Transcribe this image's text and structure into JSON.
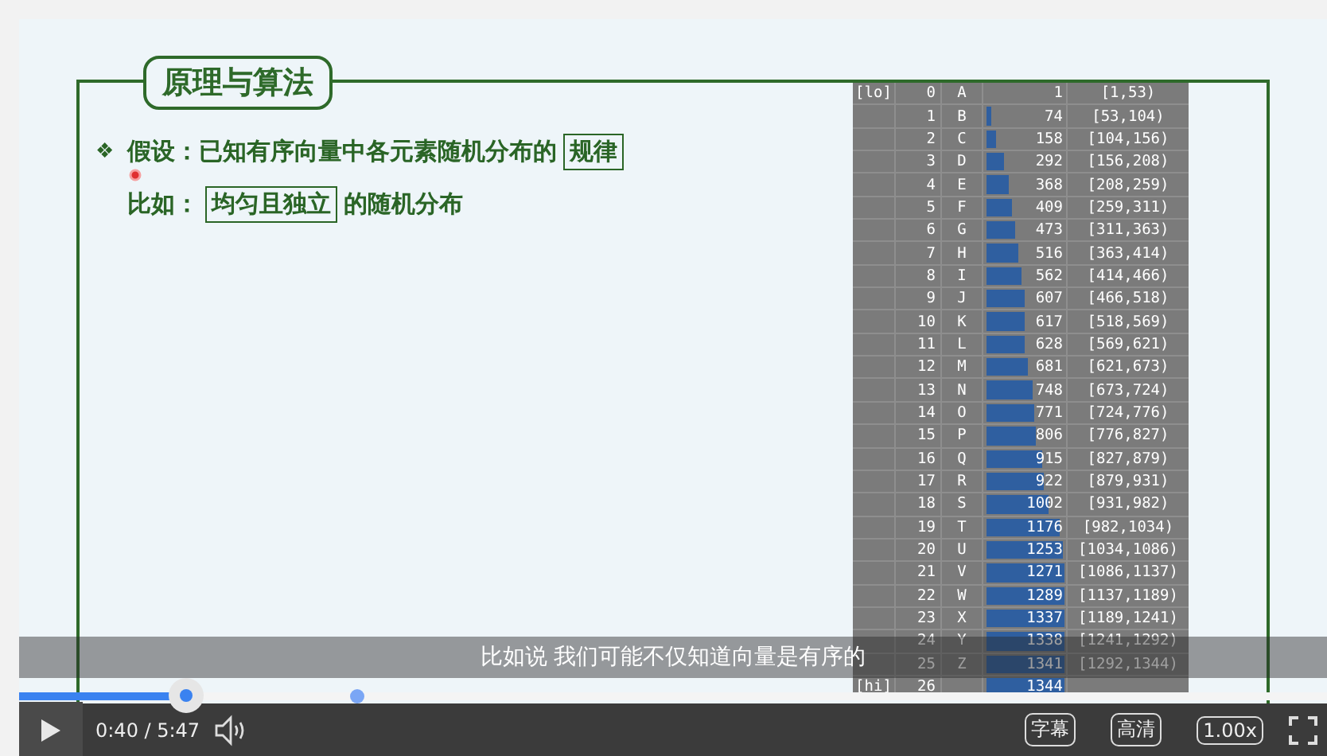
{
  "slide": {
    "title": "原理与算法",
    "lines": [
      {
        "bullet": "❖",
        "segments": [
          {
            "text": "假设：已知有序向量中各元素随机分布的",
            "boxed": false
          },
          {
            "text": "规律",
            "boxed": true
          }
        ]
      },
      {
        "segments": [
          {
            "text": "比如：",
            "boxed": false
          },
          {
            "text": "均匀且独立",
            "boxed": true
          },
          {
            "text": "的随机分布",
            "boxed": false
          }
        ]
      }
    ],
    "table": {
      "rows": [
        {
          "marker": "[lo]",
          "index": "0",
          "key": "A",
          "value": "1",
          "range": "[1,53)"
        },
        {
          "index": "1",
          "key": "B",
          "value": "74",
          "level": 0.055,
          "range": "[53,104)"
        },
        {
          "index": "2",
          "key": "C",
          "value": "158",
          "level": 0.118,
          "range": "[104,156)"
        },
        {
          "index": "3",
          "key": "D",
          "value": "292",
          "level": 0.217,
          "range": "[156,208)"
        },
        {
          "index": "4",
          "key": "E",
          "value": "368",
          "level": 0.274,
          "range": "[208,259)"
        },
        {
          "index": "5",
          "key": "F",
          "value": "409",
          "level": 0.304,
          "range": "[259,311)"
        },
        {
          "index": "6",
          "key": "G",
          "value": "473",
          "level": 0.352,
          "range": "[311,363)"
        },
        {
          "index": "7",
          "key": "H",
          "value": "516",
          "level": 0.384,
          "range": "[363,414)"
        },
        {
          "index": "8",
          "key": "I",
          "value": "562",
          "level": 0.418,
          "range": "[414,466)"
        },
        {
          "index": "9",
          "key": "J",
          "value": "607",
          "level": 0.452,
          "range": "[466,518)"
        },
        {
          "index": "10",
          "key": "K",
          "value": "617",
          "level": 0.459,
          "range": "[518,569)"
        },
        {
          "index": "11",
          "key": "L",
          "value": "628",
          "level": 0.467,
          "range": "[569,621)"
        },
        {
          "index": "12",
          "key": "M",
          "value": "681",
          "level": 0.507,
          "range": "[621,673)"
        },
        {
          "index": "13",
          "key": "N",
          "value": "748",
          "level": 0.557,
          "range": "[673,724)"
        },
        {
          "index": "14",
          "key": "O",
          "value": "771",
          "level": 0.574,
          "range": "[724,776)"
        },
        {
          "index": "15",
          "key": "P",
          "value": "806",
          "level": 0.6,
          "range": "[776,827)"
        },
        {
          "index": "16",
          "key": "Q",
          "value": "915",
          "level": 0.681,
          "range": "[827,879)"
        },
        {
          "index": "17",
          "key": "R",
          "value": "922",
          "level": 0.686,
          "range": "[879,931)"
        },
        {
          "index": "18",
          "key": "S",
          "value": "1002",
          "level": 0.746,
          "range": "[931,982)"
        },
        {
          "index": "19",
          "key": "T",
          "value": "1176",
          "level": 0.875,
          "range": "[982,1034)"
        },
        {
          "index": "20",
          "key": "U",
          "value": "1253",
          "level": 0.932,
          "range": "[1034,1086)"
        },
        {
          "index": "21",
          "key": "V",
          "value": "1271",
          "level": 0.946,
          "range": "[1086,1137)"
        },
        {
          "index": "22",
          "key": "W",
          "value": "1289",
          "level": 0.959,
          "range": "[1137,1189)"
        },
        {
          "index": "23",
          "key": "X",
          "value": "1337",
          "level": 0.995,
          "range": "[1189,1241)"
        },
        {
          "index": "24",
          "key": "Y",
          "value": "1338",
          "level": 0.996,
          "range": "[1241,1292)"
        },
        {
          "index": "25",
          "key": "Z",
          "value": "1341",
          "level": 0.998,
          "range": "[1292,1344)"
        },
        {
          "marker": "[hi]",
          "index": "26",
          "value": "1344",
          "level": 1
        }
      ]
    }
  },
  "player": {
    "subtitle": "比如说 我们可能不仅知道向量是有序的",
    "progress": {
      "level": 0.128
    },
    "time": "0:40 / 5:47",
    "buttons": [
      "字幕",
      "高清",
      "1.00x"
    ]
  }
}
